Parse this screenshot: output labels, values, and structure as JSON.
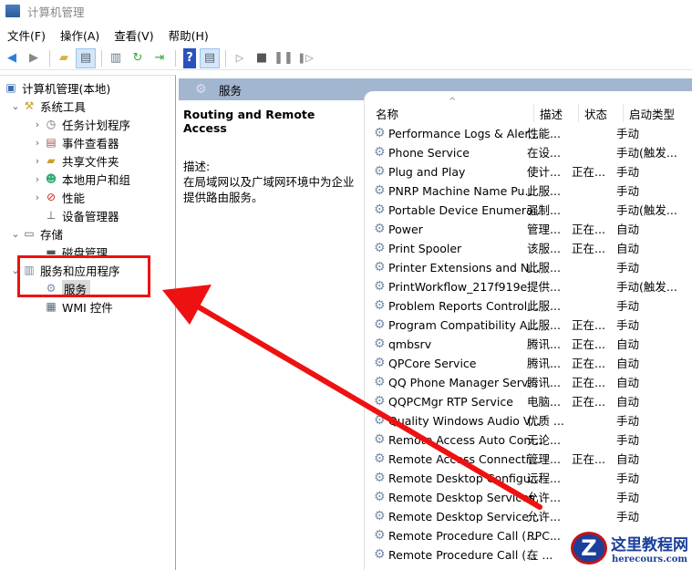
{
  "window": {
    "title": "计算机管理"
  },
  "menu": [
    "文件(F)",
    "操作(A)",
    "查看(V)",
    "帮助(H)"
  ],
  "tree": [
    {
      "label": "计算机管理(本地)",
      "icon": "computer-icon",
      "level": 0,
      "chev": ""
    },
    {
      "label": "系统工具",
      "icon": "tools-icon",
      "level": 1,
      "chev": "v"
    },
    {
      "label": "任务计划程序",
      "icon": "clock-icon",
      "level": 2,
      "chev": ">"
    },
    {
      "label": "事件查看器",
      "icon": "event-viewer-icon",
      "level": 2,
      "chev": ">"
    },
    {
      "label": "共享文件夹",
      "icon": "shared-folder-icon",
      "level": 2,
      "chev": ">"
    },
    {
      "label": "本地用户和组",
      "icon": "users-icon",
      "level": 2,
      "chev": ">"
    },
    {
      "label": "性能",
      "icon": "performance-icon",
      "level": 2,
      "chev": ">"
    },
    {
      "label": "设备管理器",
      "icon": "device-manager-icon",
      "level": 2,
      "chev": ""
    },
    {
      "label": "存储",
      "icon": "storage-icon",
      "level": 1,
      "chev": "v"
    },
    {
      "label": "磁盘管理",
      "icon": "disk-icon",
      "level": 2,
      "chev": ""
    },
    {
      "label": "服务和应用程序",
      "icon": "services-apps-icon",
      "level": 1,
      "chev": "v"
    },
    {
      "label": "服务",
      "icon": "services-icon",
      "level": 2,
      "chev": "",
      "selected": true
    },
    {
      "label": "WMI 控件",
      "icon": "wmi-icon",
      "level": 2,
      "chev": ""
    }
  ],
  "pane": {
    "header": "服务",
    "service_name": "Routing and Remote Access",
    "desc_label": "描述:",
    "desc": "在局域网以及广域网环境中为企业提供路由服务。"
  },
  "columns": [
    "名称",
    "描述",
    "状态",
    "启动类型"
  ],
  "services": [
    [
      "Performance Logs & Aler...",
      "性能...",
      "",
      "手动"
    ],
    [
      "Phone Service",
      "在设...",
      "",
      "手动(触发..."
    ],
    [
      "Plug and Play",
      "使计...",
      "正在...",
      "手动"
    ],
    [
      "PNRP Machine Name Pu...",
      "此服...",
      "",
      "手动"
    ],
    [
      "Portable Device Enumera...",
      "强制...",
      "",
      "手动(触发..."
    ],
    [
      "Power",
      "管理...",
      "正在...",
      "自动"
    ],
    [
      "Print Spooler",
      "该服...",
      "正在...",
      "自动"
    ],
    [
      "Printer Extensions and N...",
      "此服...",
      "",
      "手动"
    ],
    [
      "PrintWorkflow_217f919e",
      "提供...",
      "",
      "手动(触发..."
    ],
    [
      "Problem Reports Control...",
      "此服...",
      "",
      "手动"
    ],
    [
      "Program Compatibility A...",
      "此服...",
      "正在...",
      "手动"
    ],
    [
      "qmbsrv",
      "腾讯...",
      "正在...",
      "自动"
    ],
    [
      "QPCore Service",
      "腾讯...",
      "正在...",
      "自动"
    ],
    [
      "QQ Phone Manager Serv...",
      "腾讯...",
      "正在...",
      "自动"
    ],
    [
      "QQPCMgr RTP Service",
      "电脑...",
      "正在...",
      "自动"
    ],
    [
      "Quality Windows Audio V...",
      "优质 ...",
      "",
      "手动"
    ],
    [
      "Remote Access Auto Con...",
      "无论...",
      "",
      "手动"
    ],
    [
      "Remote Access Connecti...",
      "管理...",
      "正在...",
      "自动"
    ],
    [
      "Remote Desktop Configu...",
      "远程...",
      "",
      "手动"
    ],
    [
      "Remote Desktop Services",
      "允许...",
      "",
      "手动"
    ],
    [
      "Remote Desktop Service...",
      "允许...",
      "",
      "手动"
    ],
    [
      "Remote Procedure Call (...",
      "RPC...",
      "",
      ""
    ],
    [
      "Remote Procedure Call (...",
      "在 ...",
      "",
      ""
    ]
  ],
  "watermark": {
    "title": "这里教程网",
    "url": "herecours.com"
  },
  "colors": {
    "annotation": "#ee1111",
    "header": "#a3b6cf"
  }
}
